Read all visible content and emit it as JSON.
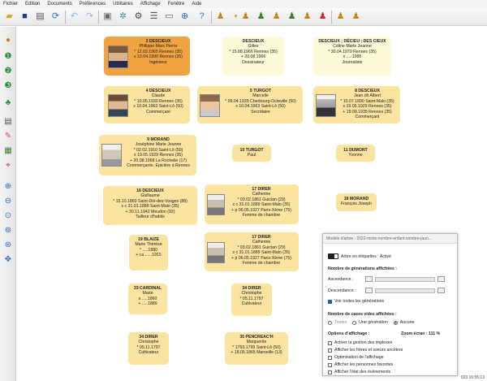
{
  "menu": [
    "Fichier",
    "Edition",
    "Documents",
    "Préférences",
    "Utilitaires",
    "Affichage",
    "Fenêtre",
    "Aide"
  ],
  "toolbar_icons": [
    "folder-icon",
    "save-icon",
    "print-preview-icon",
    "refresh-icon",
    "undo-icon",
    "redo-icon",
    "stop-icon",
    "tree-view-icon",
    "settings-icon",
    "list-icon",
    "window-icon",
    "search-icon",
    "help-icon",
    "person-dropdown-icon",
    "add-parent-icon",
    "add-person-icon",
    "add-spouse-icon",
    "add-child-icon",
    "add-sibling-icon",
    "delete-person-icon",
    "navigate-icon",
    "add-relative-icon"
  ],
  "left_icons": [
    "person-icon",
    "level-1-icon",
    "level-2-icon",
    "level-3-icon",
    "tree-icon",
    "print-icon",
    "brush-icon",
    "grid-icon",
    "map-pin-icon",
    "zoom-in-icon",
    "zoom-out-icon",
    "zoom-fit-icon",
    "zoom-100-icon",
    "zoom-page-icon",
    "expand-icon"
  ],
  "boxes": [
    {
      "id": "p2",
      "lines": [
        "2 DESCIEUX",
        "Philippe Marc Pierre",
        "* 12.03.1965 Rennes (35)",
        "x 10.04.1990 Rennes (35)",
        "",
        "Ingénieur"
      ]
    },
    {
      "id": "px1",
      "lines": [
        "DESCIEUX",
        "Gilles",
        "* 15.08.1966 Rennes (35)",
        "",
        "+ 20.08.1966",
        "Dessinateur"
      ]
    },
    {
      "id": "px2",
      "lines": [
        "DESCIEUX ; DÉCIEU ; DES CIEUX",
        "Céline Marie Jeanne",
        "* 30.04.1970 Rennes (35)",
        "x .....1995",
        "",
        "Journaliste"
      ]
    },
    {
      "id": "p4",
      "lines": [
        "4 DESCIEUX",
        "Claude",
        "* 10.05.1930 Rennes (35)",
        "x 10.04.1963 Saint-Lô (50)",
        "",
        "Commerçant"
      ]
    },
    {
      "id": "p5",
      "lines": [
        "5 TURGOT",
        "Marcelle",
        "* 09.04.1935 Cherbourg-Octeville (50)",
        "x 10.04.1963 Saint-Lô (50)",
        "",
        "Secrétaire"
      ]
    },
    {
      "id": "p8",
      "lines": [
        "8 DESCIEUX",
        "Jean dit Albert",
        "* 10.07.1890 Saint-Malo (35)",
        "x 19.05.1929 Rennes (35)",
        "+ 19.09.1935 Rennes (35)",
        "Commerçant"
      ]
    },
    {
      "id": "p9",
      "lines": [
        "9 MORAND",
        "Joséphine Marie Jeanne",
        "* 02.02.1910 Saint-Lô (50)",
        "x 19.05.1929 Rennes (35)",
        "+ 20.08.1998 La Rochelle (17)",
        "Commerçante, Epicière à Rennes"
      ]
    },
    {
      "id": "p10",
      "lines": [
        "10 TURGOT",
        "Paul"
      ]
    },
    {
      "id": "p11",
      "lines": [
        "11 DUMONT",
        "Yvonne"
      ]
    },
    {
      "id": "p16",
      "lines": [
        "16 DESCIEUX",
        "Guillaume",
        "* 15.10.1860 Saint-Dié-des-Vosges (88)",
        "x c 31.01.1889 Saint-Malo (35)",
        "+ 30.11.1942 Meudon (92)",
        "Tailleur d'habits"
      ]
    },
    {
      "id": "p17a",
      "lines": [
        "17 DIRER",
        "Catherine",
        "* 03.02.1861 Guiclan (29)",
        "x c 31.01.1889 Saint-Malo (35)",
        "+ p 06.05.1927 Paris-Xème (75)",
        "Femme de chambre"
      ]
    },
    {
      "id": "p18",
      "lines": [
        "18 MORAND",
        "François Joseph"
      ]
    },
    {
      "id": "p19",
      "lines": [
        "19 BLAIZE",
        "Marie Thérèse",
        "* .....1880",
        "",
        "+ ca ......1915"
      ]
    },
    {
      "id": "p17b",
      "lines": [
        "17 DIRER",
        "Catherine",
        "* 03.02.1861 Guiclan (29)",
        "x c 31.01.1889 Saint-Malo (35)",
        "+ p 06.05.1927 Paris-Xème (75)",
        "Femme de chambre"
      ]
    },
    {
      "id": "p33",
      "lines": [
        "33 CARDINAL",
        "Marie",
        "",
        "x .....1860",
        "+ .....1889"
      ]
    },
    {
      "id": "p34a",
      "lines": [
        "34 DIRER",
        "Christophe",
        "* 05.11.1797",
        "",
        "Cultivateur"
      ]
    },
    {
      "id": "p34b",
      "lines": [
        "34 DIRER",
        "Christophe",
        "* 05.11.1797",
        "",
        "Cultivateur"
      ]
    },
    {
      "id": "p35",
      "lines": [
        "35 PENCREAC'H",
        "Marguerite",
        "* 1793.1795 Saint-Lô (50)",
        "",
        "+ 18.05.1865 Marseille (13)"
      ]
    }
  ],
  "dialog": {
    "title": "Modèle d'arbre : 2022-mixte-nombre-enfant-sombre-jaun...",
    "label_toggle": "Arbre en étiquettes : Activé",
    "section_generations": "Nombre de générations affichées :",
    "ascendance_label": "Ascendance :",
    "descendance_label": "Descendance :",
    "show_all_label": "Voir toutes les générations",
    "section_empty": "Nombre de cases vides affichées :",
    "radio_all": "Toutes",
    "radio_one": "Une génération",
    "radio_none": "Aucune",
    "section_options": "Options d'affichage :",
    "zoom_label": "Zoom écran : 111 %",
    "options": [
      "Activer la gestion des implexes",
      "Afficher les frères et soeurs ancêtres",
      "Optimisation de l'affichage",
      "Afficher les personnes favorites",
      "Afficher l'état des événements"
    ]
  },
  "status": "023 16:55:13"
}
